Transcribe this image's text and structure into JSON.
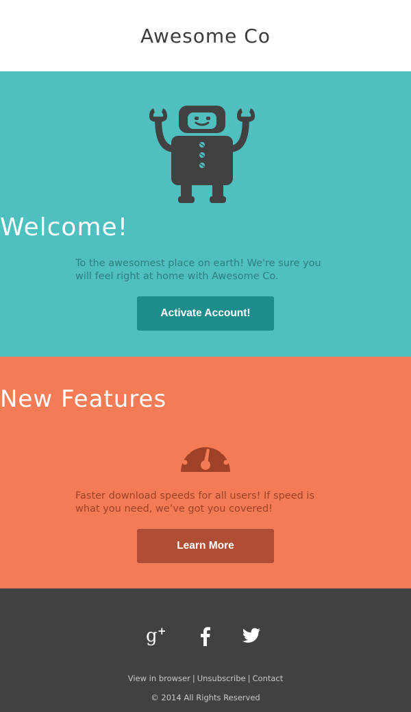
{
  "header": {
    "brand": "Awesome Co"
  },
  "hero": {
    "icon": "robot-icon",
    "title": "Welcome!",
    "text": "To the awesomest place on earth! We're sure you will feel right at home with Awesome Co.",
    "button_label": "Activate Account!"
  },
  "features": {
    "title": "New Features",
    "icon": "speedometer-icon",
    "text": "Faster download speeds for all users! If speed is what you need, we’ve got you covered!",
    "button_label": "Learn More"
  },
  "footer": {
    "social": [
      "google-plus-icon",
      "facebook-icon",
      "twitter-icon"
    ],
    "links": {
      "view_in_browser": "View in browser",
      "unsubscribe": "Unsubscribe",
      "contact": "Contact",
      "separator": "|"
    },
    "copyright": "© 2014 All Rights Reserved"
  },
  "colors": {
    "teal": "#50bfc0",
    "teal_button": "#1d8d8b",
    "coral": "#f37b56",
    "coral_button": "#b04d35",
    "dark": "#414141"
  }
}
